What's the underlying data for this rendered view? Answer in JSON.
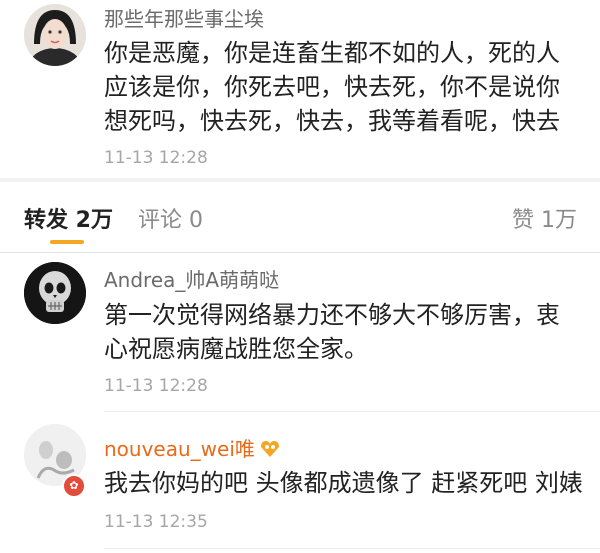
{
  "colors": {
    "accent_tab": "#f5a623",
    "vip_name": "#e86a1b",
    "meta_text": "#a6a6a6",
    "badge": "#e34b3b"
  },
  "post": {
    "username": "那些年那些事尘埃",
    "lines": [
      "你是恶魔，你是连畜生都不如的人，死的人",
      "应该是你，你死去吧，快去死，你不是说你",
      "想死吗，快去死，快去，我等着看呢，快去"
    ],
    "time": "11-13 12:28"
  },
  "tabs": {
    "repost": "转发 2万",
    "comment": "评论 0",
    "like": "赞 1万"
  },
  "comments": [
    {
      "username": "Andrea_帅A萌萌哒",
      "lines": [
        "第一次觉得网络暴力还不够大不够厉害，衷",
        "心祝愿病魔战胜您全家。"
      ],
      "time": "11-13 12:28"
    },
    {
      "username": "nouveau_wei唯",
      "lines": [
        "我去你妈的吧 头像都成遗像了 赶紧死吧 刘婊"
      ],
      "time": "11-13 12:35",
      "vip_icon": "vip-badge-icon",
      "avatar_badge_icon": "hongkong-flag-icon"
    }
  ]
}
